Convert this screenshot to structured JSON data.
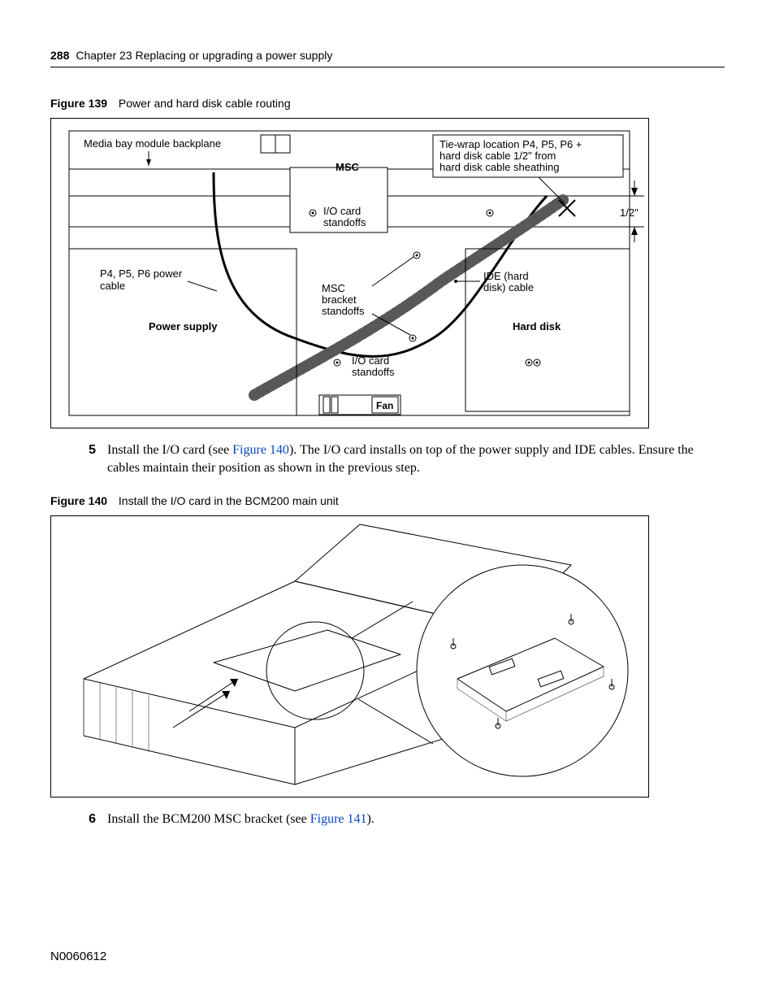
{
  "header": {
    "page_number": "288",
    "chapter_line": "Chapter 23   Replacing or upgrading a power supply"
  },
  "figures": {
    "fig139": {
      "num": "Figure 139",
      "title": "Power and hard disk cable routing",
      "labels": {
        "media_backplane": "Media bay module backplane",
        "msc": "MSC",
        "tiewrap_l1": "Tie-wrap location P4, P5, P6 +",
        "tiewrap_l2": "hard disk cable 1/2\" from",
        "tiewrap_l3": "hard disk cable sheathing",
        "half_inch": "1/2\"",
        "io_standoffs_top": "I/O card",
        "io_standoffs_top2": "standoffs",
        "p456_l1": "P4, P5, P6 power",
        "p456_l2": "cable",
        "msc_bracket_l1": "MSC",
        "msc_bracket_l2": "bracket",
        "msc_bracket_l3": "standoffs",
        "ide_l1": "IDE (hard",
        "ide_l2": "disk) cable",
        "power_supply": "Power supply",
        "hard_disk": "Hard disk",
        "io_standoffs_bot": "I/O card",
        "io_standoffs_bot2": "standoffs",
        "fan": "Fan"
      }
    },
    "fig140": {
      "num": "Figure 140",
      "title": "Install the I/O card in the BCM200 main unit"
    }
  },
  "steps": {
    "s5": {
      "num": "5",
      "text_a": "Install the I/O card (see ",
      "link": "Figure 140",
      "text_b": "). The I/O card installs on top of the power supply and IDE cables. Ensure the cables maintain their position as shown in the previous step."
    },
    "s6": {
      "num": "6",
      "text_a": "Install the BCM200 MSC bracket (see ",
      "link": "Figure 141",
      "text_b": ")."
    }
  },
  "footer": {
    "doc_id": "N0060612"
  }
}
